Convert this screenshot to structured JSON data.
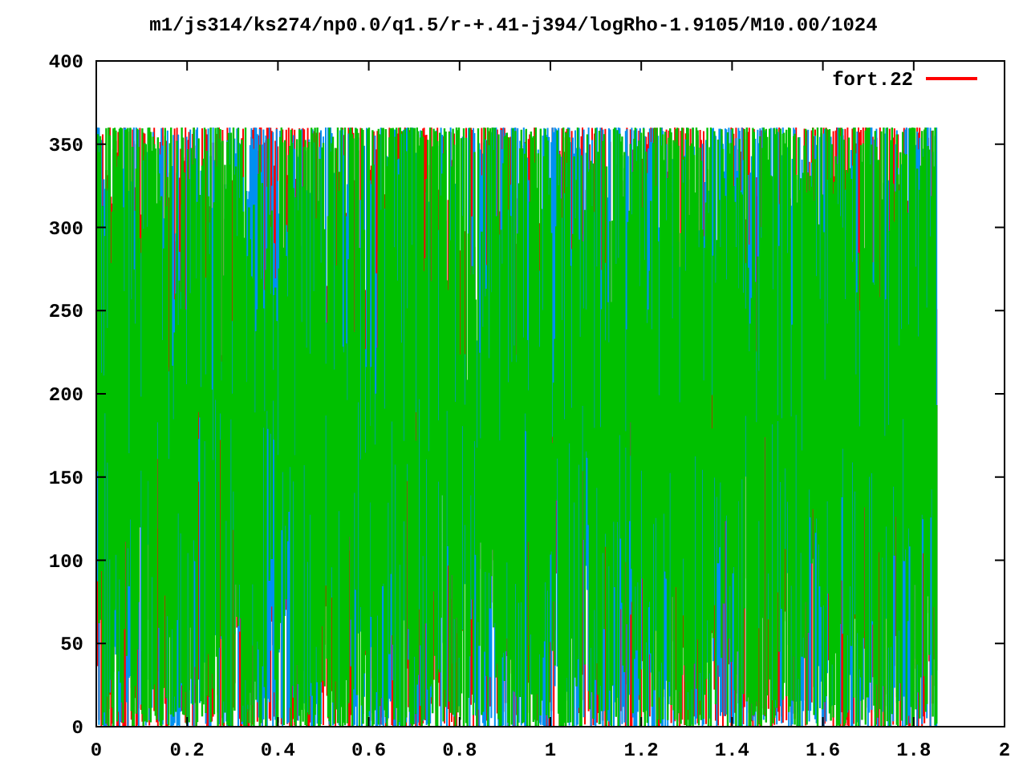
{
  "title": "m1/js314/ks274/np0.0/q1.5/r-+.41-j394/logRho-1.9105/M10.00/1024",
  "legend": {
    "label": "fort.22",
    "color": "#ff0000"
  },
  "x_tick_labels": [
    "0",
    "0.2",
    "0.4",
    "0.6",
    "0.8",
    "1",
    "1.2",
    "1.4",
    "1.6",
    "1.8",
    "2"
  ],
  "y_tick_labels": [
    "400",
    "350",
    "300",
    "250",
    "200",
    "150",
    "100",
    "50",
    "0"
  ]
}
